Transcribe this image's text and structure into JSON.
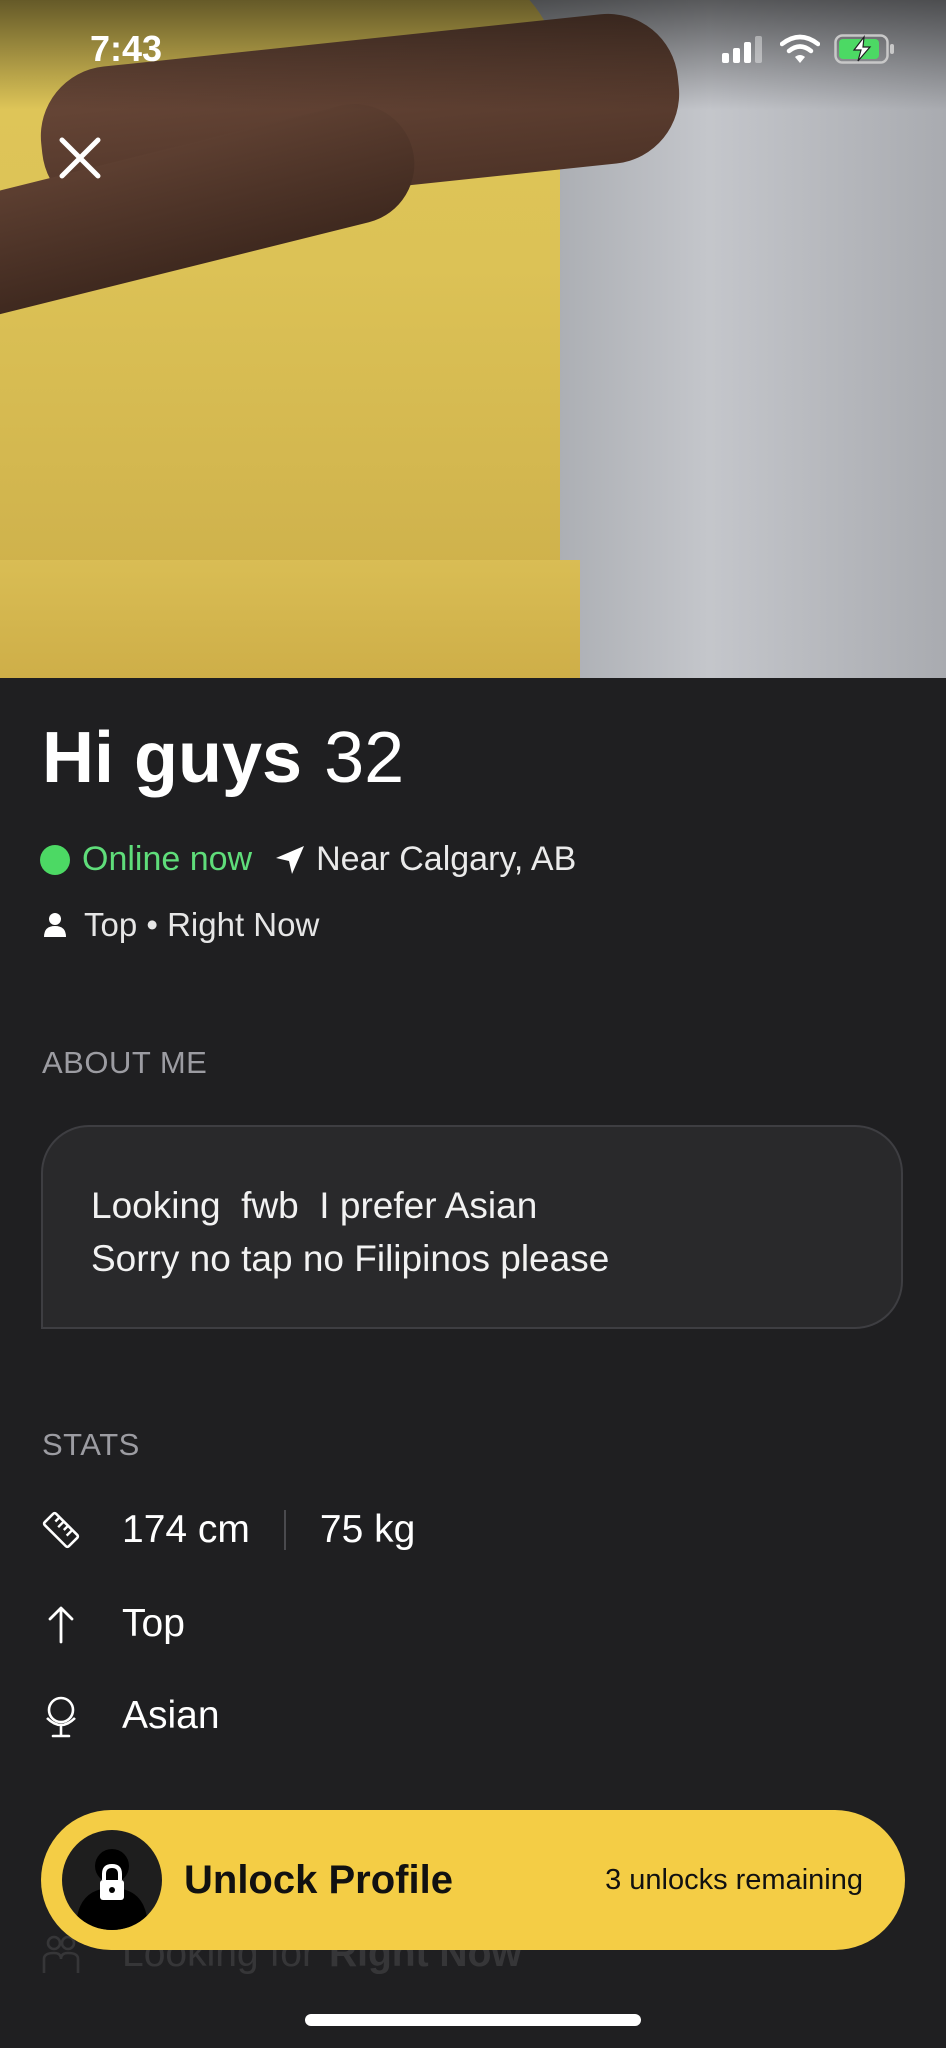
{
  "status_bar": {
    "time": "7:43"
  },
  "profile": {
    "name": "Hi guys",
    "age": "32",
    "online_status": "Online now",
    "location": "Near Calgary, AB",
    "role_line": "Top • Right Now"
  },
  "about": {
    "label": "ABOUT ME",
    "line1": "Looking  fwb  I prefer Asian",
    "line2": "Sorry no tap no Filipinos please"
  },
  "stats": {
    "label": "STATS",
    "height": "174 cm",
    "weight": "75 kg",
    "position": "Top",
    "ethnicity": "Asian",
    "looking_for_label": "Looking for",
    "looking_for_value": "Right Now"
  },
  "unlock": {
    "title": "Unlock Profile",
    "remaining": "3 unlocks remaining"
  },
  "colors": {
    "accent_yellow": "#f4cd45",
    "online_green": "#4cd964",
    "background": "#1f1f21"
  },
  "icons": [
    "close-icon",
    "signal-icon",
    "wifi-icon",
    "battery-charging-icon",
    "location-arrow-icon",
    "person-icon",
    "ruler-icon",
    "arrow-up-icon",
    "globe-icon",
    "lock-icon"
  ]
}
